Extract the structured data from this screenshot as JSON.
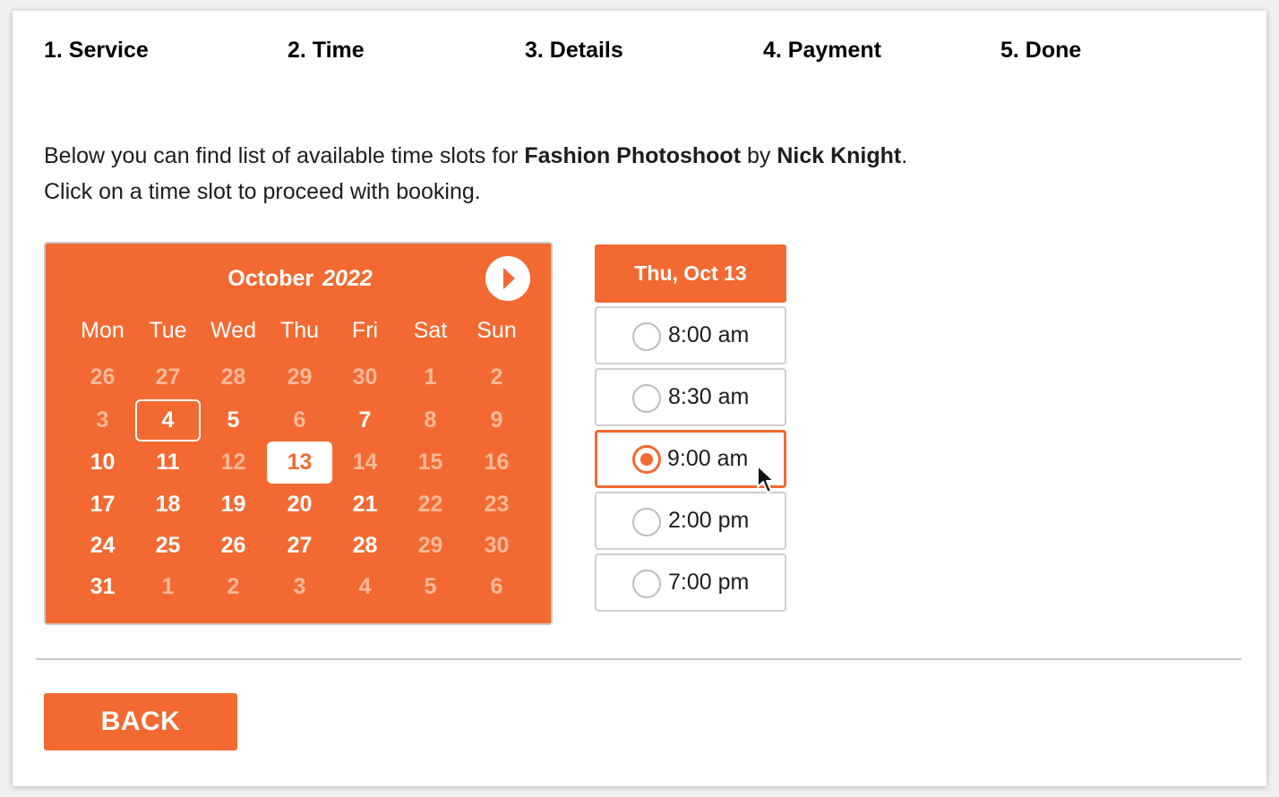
{
  "steps": [
    {
      "label": "1. Service",
      "state": "done"
    },
    {
      "label": "2. Time",
      "state": "done"
    },
    {
      "label": "3. Details",
      "state": "todo"
    },
    {
      "label": "4. Payment",
      "state": "todo"
    },
    {
      "label": "5. Done",
      "state": "todo"
    }
  ],
  "intro": {
    "line1_prefix": "Below you can find list of available time slots for ",
    "service": "Fashion Photoshoot",
    "by": " by ",
    "staff": "Nick Knight",
    "period": ".",
    "line2": "Click on a time slot to proceed with booking."
  },
  "calendar": {
    "month": "October",
    "year": "2022",
    "next_icon": "chevron-right-icon",
    "weekdays": [
      "Mon",
      "Tue",
      "Wed",
      "Thu",
      "Fri",
      "Sat",
      "Sun"
    ],
    "weeks": [
      [
        {
          "d": "26",
          "s": "muted"
        },
        {
          "d": "27",
          "s": "muted"
        },
        {
          "d": "28",
          "s": "muted"
        },
        {
          "d": "29",
          "s": "muted"
        },
        {
          "d": "30",
          "s": "muted"
        },
        {
          "d": "1",
          "s": "muted"
        },
        {
          "d": "2",
          "s": "muted"
        }
      ],
      [
        {
          "d": "3",
          "s": "muted"
        },
        {
          "d": "4",
          "s": "today"
        },
        {
          "d": "5",
          "s": "active"
        },
        {
          "d": "6",
          "s": "muted"
        },
        {
          "d": "7",
          "s": "active"
        },
        {
          "d": "8",
          "s": "muted"
        },
        {
          "d": "9",
          "s": "muted"
        }
      ],
      [
        {
          "d": "10",
          "s": "active"
        },
        {
          "d": "11",
          "s": "active"
        },
        {
          "d": "12",
          "s": "muted"
        },
        {
          "d": "13",
          "s": "selected"
        },
        {
          "d": "14",
          "s": "muted"
        },
        {
          "d": "15",
          "s": "muted"
        },
        {
          "d": "16",
          "s": "muted"
        }
      ],
      [
        {
          "d": "17",
          "s": "active"
        },
        {
          "d": "18",
          "s": "active"
        },
        {
          "d": "19",
          "s": "active"
        },
        {
          "d": "20",
          "s": "active"
        },
        {
          "d": "21",
          "s": "active"
        },
        {
          "d": "22",
          "s": "muted"
        },
        {
          "d": "23",
          "s": "muted"
        }
      ],
      [
        {
          "d": "24",
          "s": "active"
        },
        {
          "d": "25",
          "s": "active"
        },
        {
          "d": "26",
          "s": "active"
        },
        {
          "d": "27",
          "s": "active"
        },
        {
          "d": "28",
          "s": "active"
        },
        {
          "d": "29",
          "s": "muted"
        },
        {
          "d": "30",
          "s": "muted"
        }
      ],
      [
        {
          "d": "31",
          "s": "active"
        },
        {
          "d": "1",
          "s": "muted"
        },
        {
          "d": "2",
          "s": "muted"
        },
        {
          "d": "3",
          "s": "muted"
        },
        {
          "d": "4",
          "s": "muted"
        },
        {
          "d": "5",
          "s": "muted"
        },
        {
          "d": "6",
          "s": "muted"
        }
      ]
    ]
  },
  "slots": {
    "header": "Thu, Oct 13",
    "items": [
      {
        "label": "8:00 am",
        "selected": false
      },
      {
        "label": "8:30 am",
        "selected": false
      },
      {
        "label": "9:00 am",
        "selected": true
      },
      {
        "label": "2:00 pm",
        "selected": false
      },
      {
        "label": "7:00 pm",
        "selected": false
      }
    ]
  },
  "back_label": "BACK",
  "colors": {
    "accent": "#f26a32",
    "inactive_bar": "#bfc3c6",
    "muted_day": "#f9b89a",
    "text": "#1d1d1d"
  }
}
